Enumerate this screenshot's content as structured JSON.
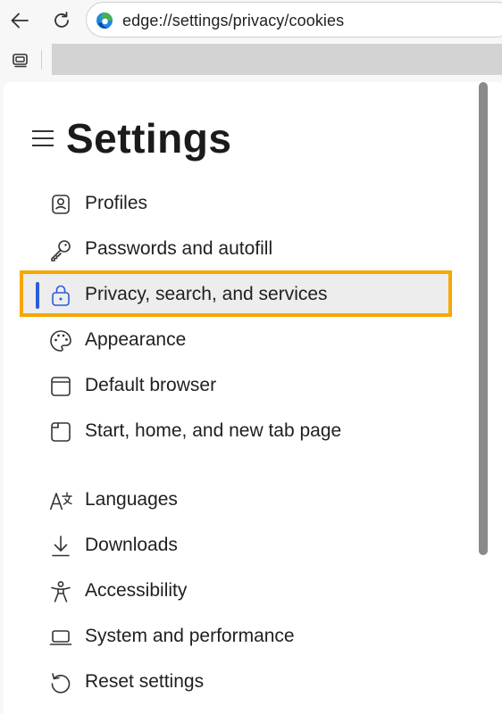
{
  "browser": {
    "url": "edge://settings/privacy/cookies",
    "icons": {
      "back": "back-arrow-icon",
      "refresh": "refresh-icon",
      "logo": "edge-logo-icon",
      "collections": "collections-icon"
    }
  },
  "settings": {
    "title": "Settings",
    "menu_icon": "hamburger-menu-icon",
    "selected_index": 2,
    "accent_color": "#2a5dd8",
    "highlight_color": "#f5a800",
    "items": [
      {
        "label": "Profiles",
        "icon": "profile-icon"
      },
      {
        "label": "Passwords and autofill",
        "icon": "key-icon"
      },
      {
        "label": "Privacy, search, and services",
        "icon": "lock-icon"
      },
      {
        "label": "Appearance",
        "icon": "palette-icon"
      },
      {
        "label": "Default browser",
        "icon": "browser-icon"
      },
      {
        "label": "Start, home, and new tab page",
        "icon": "home-page-icon"
      },
      {
        "label": "Languages",
        "icon": "languages-icon"
      },
      {
        "label": "Downloads",
        "icon": "download-icon"
      },
      {
        "label": "Accessibility",
        "icon": "accessibility-icon"
      },
      {
        "label": "System and performance",
        "icon": "laptop-icon"
      },
      {
        "label": "Reset settings",
        "icon": "reset-icon"
      }
    ]
  }
}
